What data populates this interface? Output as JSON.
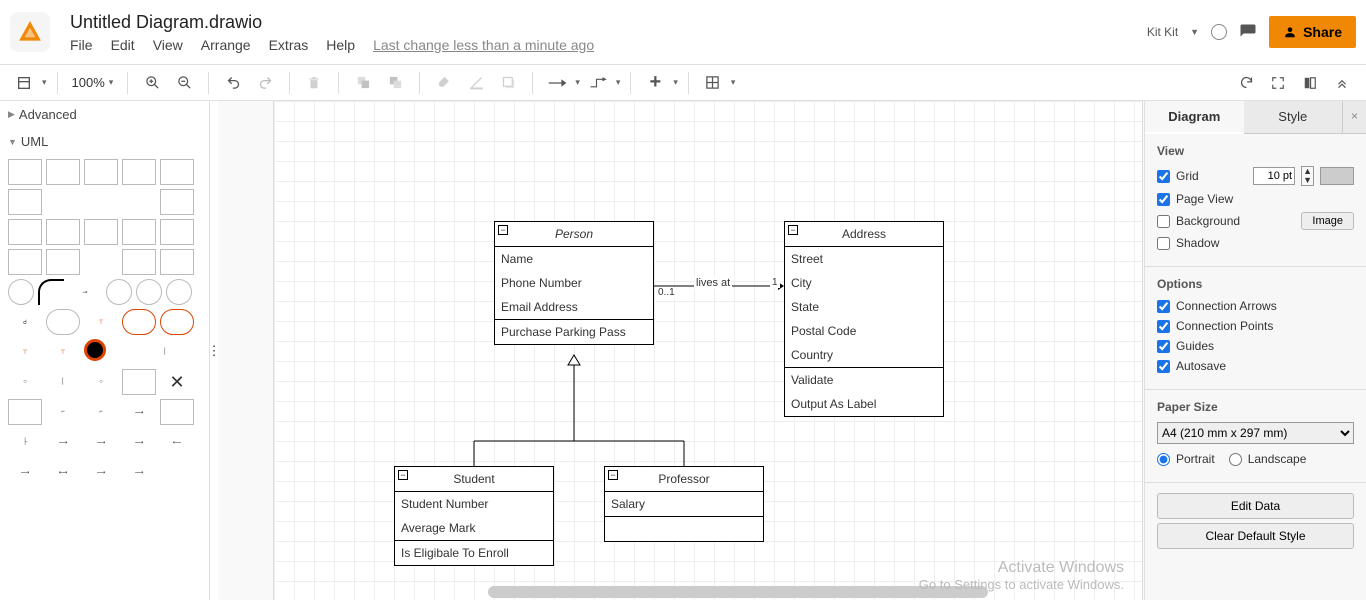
{
  "header": {
    "doc_title": "Untitled Diagram.drawio",
    "user": "Kit Kit",
    "share_label": "Share",
    "last_change": "Last change less than a minute ago"
  },
  "menu": {
    "file": "File",
    "edit": "Edit",
    "view": "View",
    "arrange": "Arrange",
    "extras": "Extras",
    "help": "Help"
  },
  "toolbar": {
    "zoom": "100%"
  },
  "sidebar": {
    "advanced": "Advanced",
    "uml": "UML"
  },
  "canvas": {
    "person": {
      "title": "Person",
      "attrs": [
        "Name",
        "Phone Number",
        "Email Address"
      ],
      "ops": [
        "Purchase Parking Pass"
      ]
    },
    "address": {
      "title": "Address",
      "attrs": [
        "Street",
        "City",
        "State",
        "Postal Code",
        "Country"
      ],
      "ops": [
        "Validate",
        "Output As Label"
      ]
    },
    "student": {
      "title": "Student",
      "attrs": [
        "Student Number",
        "Average Mark"
      ],
      "ops": [
        "Is Eligibale To Enroll"
      ]
    },
    "professor": {
      "title": "Professor",
      "attrs": [
        "Salary"
      ]
    },
    "edge": {
      "label": "lives at",
      "mult_left": "0..1",
      "mult_right": "1"
    }
  },
  "panel": {
    "tab_diagram": "Diagram",
    "tab_style": "Style",
    "view": "View",
    "grid": "Grid",
    "grid_pt": "10 pt",
    "page_view": "Page View",
    "background": "Background",
    "image_btn": "Image",
    "shadow": "Shadow",
    "options": "Options",
    "conn_arrows": "Connection Arrows",
    "conn_points": "Connection Points",
    "guides": "Guides",
    "autosave": "Autosave",
    "paper_size": "Paper Size",
    "paper_value": "A4 (210 mm x 297 mm)",
    "portrait": "Portrait",
    "landscape": "Landscape",
    "edit_data": "Edit Data",
    "clear_style": "Clear Default Style"
  },
  "watermark": {
    "l1": "Activate Windows",
    "l2": "Go to Settings to activate Windows."
  }
}
